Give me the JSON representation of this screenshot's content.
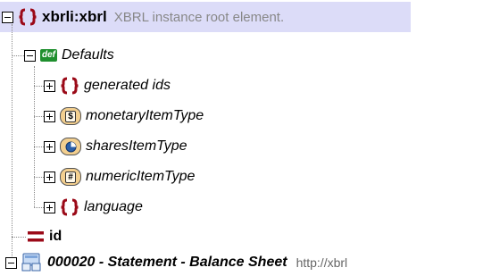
{
  "tree": {
    "root": {
      "label": "xbrli:xbrl",
      "description": "XBRL instance root element.",
      "icon": "element-braces-icon"
    },
    "defaults": {
      "badge": "def",
      "label": "Defaults",
      "children": [
        {
          "label": "generated ids",
          "icon": "element-braces-icon"
        },
        {
          "label": "monetaryItemType",
          "icon": "dollar-type-icon",
          "glyph": "$"
        },
        {
          "label": "sharesItemType",
          "icon": "pie-type-icon"
        },
        {
          "label": "numericItemType",
          "icon": "hash-type-icon",
          "glyph": "#"
        },
        {
          "label": "language",
          "icon": "element-braces-icon"
        }
      ]
    },
    "id_attr": {
      "label": "id",
      "icon": "attribute-equals-icon"
    },
    "statement": {
      "label": "000020 - Statement - Balance Sheet",
      "trailing": "http://xbrl",
      "icon": "linkrole-network-icon"
    }
  },
  "colors": {
    "accent": "#9b0a18",
    "selection": "#dcdcf8",
    "badge_green": "#1f8f2e",
    "type_fill": "#f3cf8f"
  }
}
